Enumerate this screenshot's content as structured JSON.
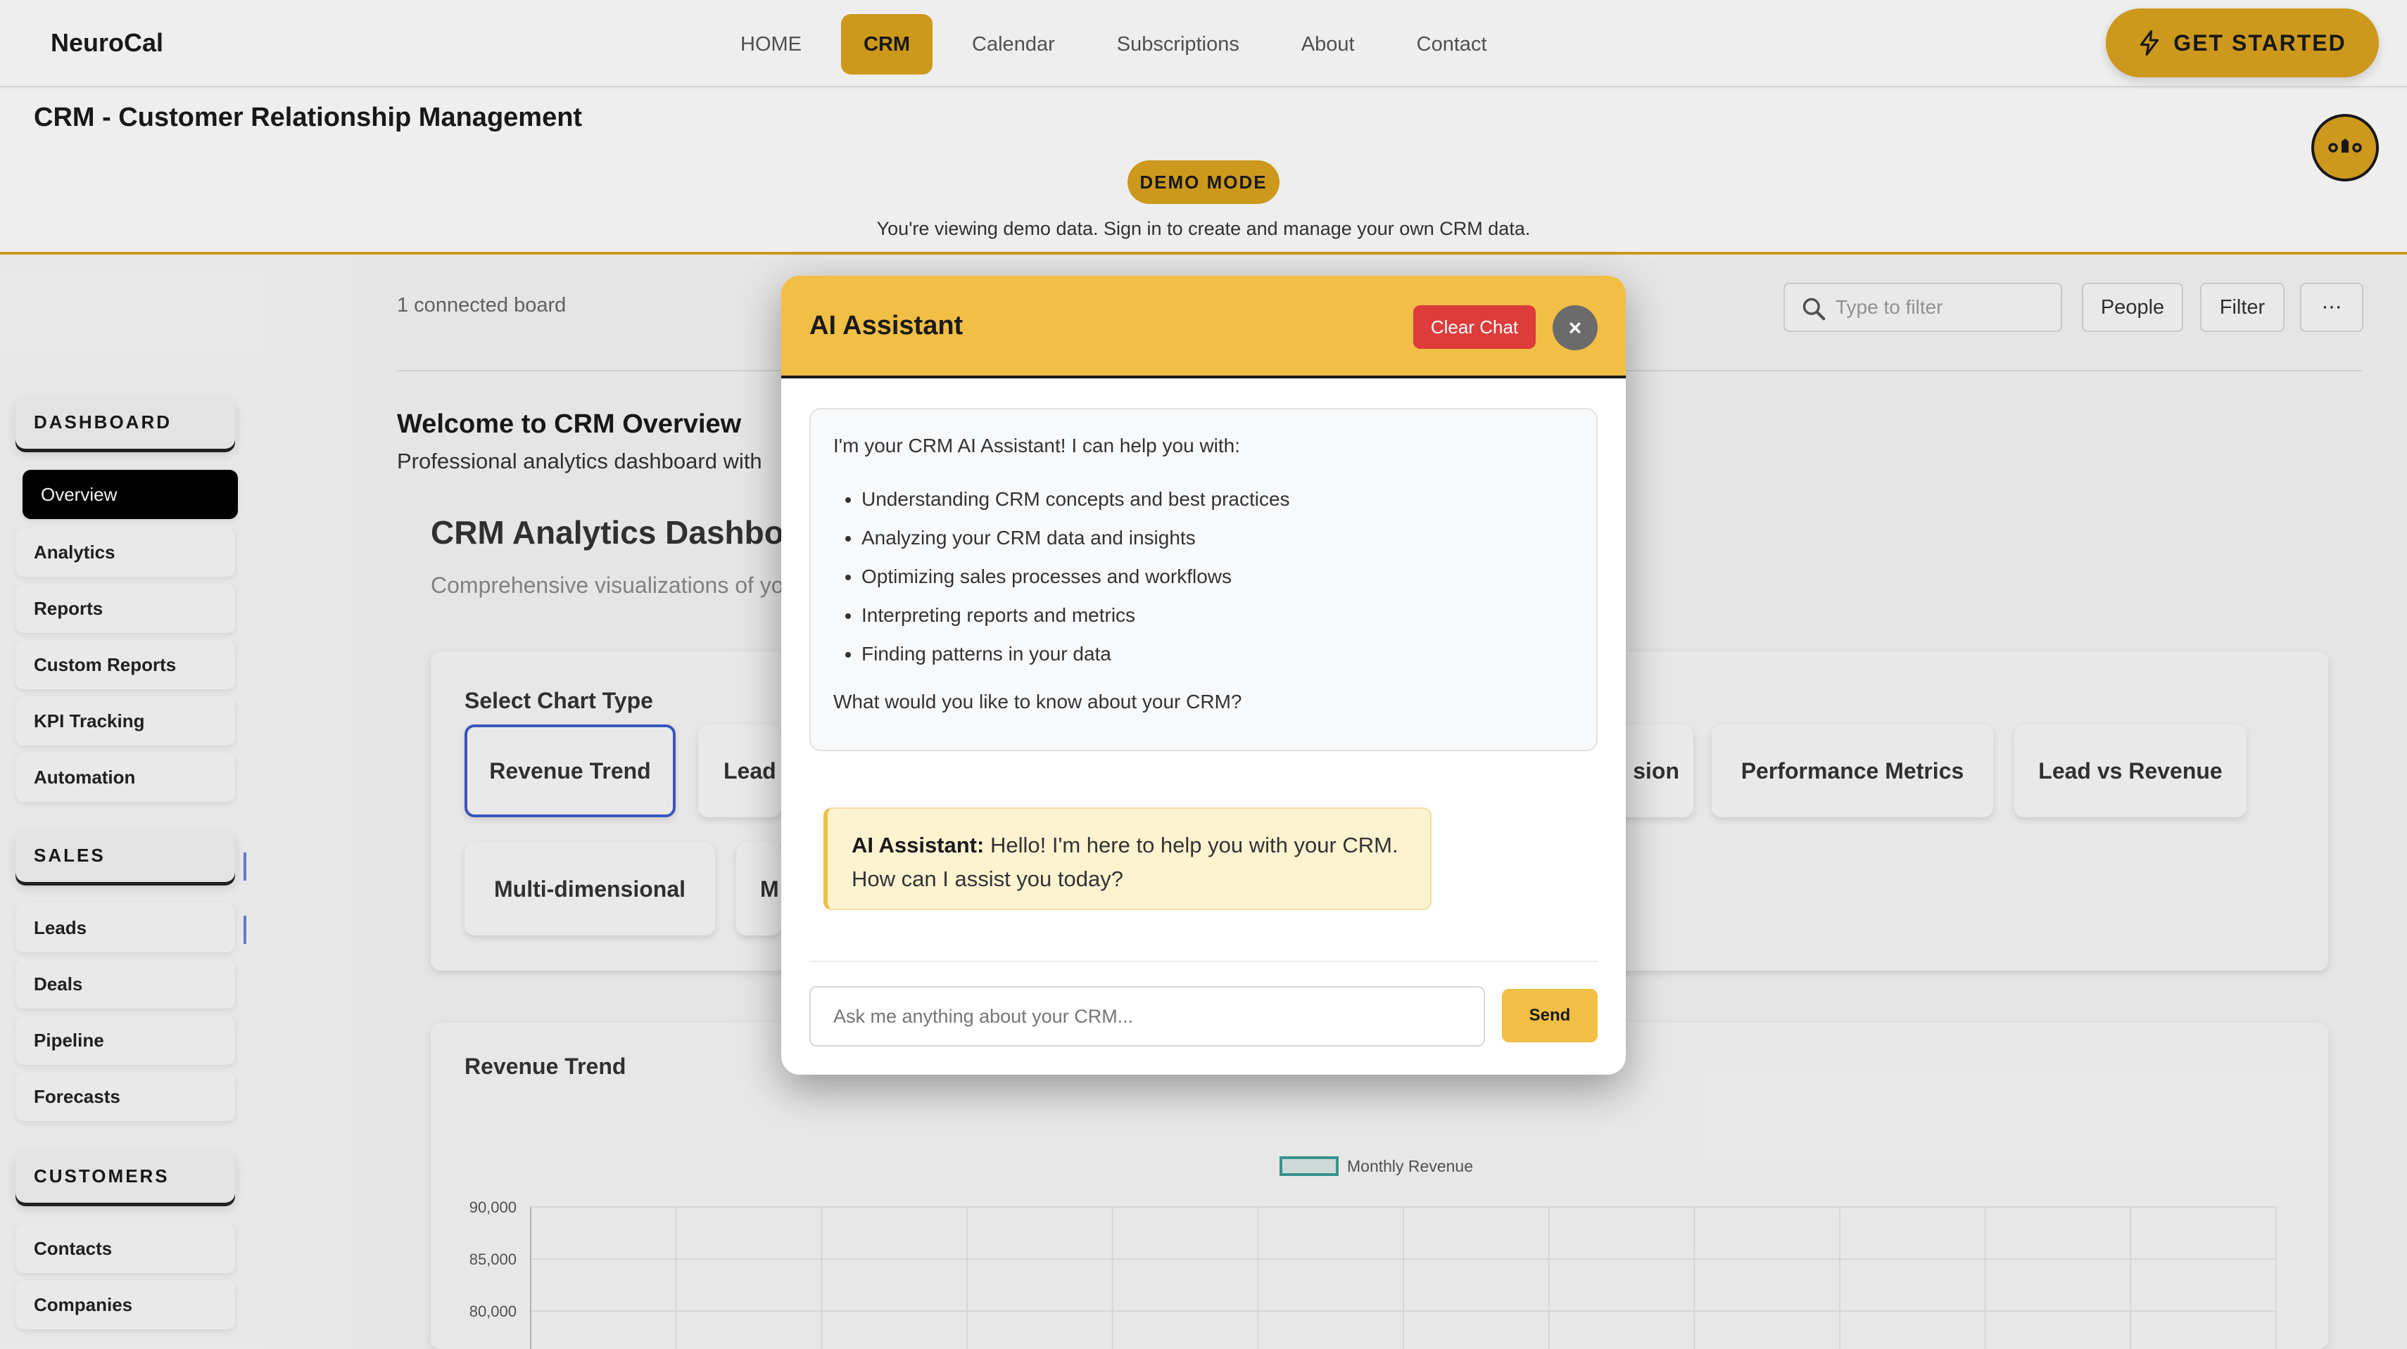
{
  "nav": {
    "brand": "NeuroCal",
    "links": [
      "HOME",
      "CRM",
      "Calendar",
      "Subscriptions",
      "About",
      "Contact"
    ],
    "active": "CRM",
    "cta": "GET STARTED"
  },
  "header": {
    "title": "CRM - Customer Relationship Management",
    "badge": "DEMO MODE",
    "demo_text": "You're viewing demo data. Sign in to create and manage your own CRM data."
  },
  "sidebar": {
    "sections": [
      {
        "title": "DASHBOARD",
        "items": [
          "Overview",
          "Analytics",
          "Reports",
          "Custom Reports",
          "KPI Tracking",
          "Automation"
        ]
      },
      {
        "title": "SALES",
        "items": [
          "Leads",
          "Deals",
          "Pipeline",
          "Forecasts"
        ]
      },
      {
        "title": "CUSTOMERS",
        "items": [
          "Contacts",
          "Companies"
        ]
      }
    ],
    "active_item": "Overview"
  },
  "toolbar": {
    "board_text": "1 connected board",
    "filter_placeholder": "Type to filter",
    "people_label": "People",
    "filter_label": "Filter",
    "more_label": "⋯"
  },
  "main": {
    "welcome_title": "Welcome to CRM Overview",
    "welcome_sub": "Professional analytics dashboard with",
    "dash_title": "CRM Analytics Dashbo",
    "dash_sub": "Comprehensive visualizations of yo",
    "select_label": "Select Chart Type",
    "chips": [
      "Revenue Trend",
      "Lead",
      "sion",
      "Performance Metrics",
      "Lead vs Revenue",
      "Multi-dimensional",
      "M"
    ],
    "chart_title": "Revenue Trend"
  },
  "chart_data": {
    "type": "bar",
    "title": "Revenue Trend",
    "legend": [
      "Monthly Revenue"
    ],
    "legend_placement": "top",
    "series": [
      {
        "name": "Monthly Revenue",
        "values": []
      }
    ],
    "y_ticks": [
      "90,000",
      "85,000",
      "80,000"
    ],
    "ylim": [
      80000,
      90000
    ],
    "grid": true,
    "series_color": "#3b9a94"
  },
  "assistant": {
    "title": "AI Assistant",
    "clear_label": "Clear Chat",
    "close_label": "×",
    "intro": "I'm your CRM AI Assistant! I can help you with:",
    "capabilities": [
      "Understanding CRM concepts and best practices",
      "Analyzing your CRM data and insights",
      "Optimizing sales processes and workflows",
      "Interpreting reports and metrics",
      "Finding patterns in your data"
    ],
    "question": "What would you like to know about your CRM?",
    "message_sender": "AI Assistant:",
    "message_text": " Hello! I'm here to help you with your CRM. How can I assist you today?",
    "input_placeholder": "Ask me anything about your CRM...",
    "send_label": "Send"
  },
  "colors": {
    "accent": "#d9a21e",
    "modal_header": "#f1bf45",
    "danger": "#de3b3b",
    "selected_border": "#3b5bc6"
  }
}
